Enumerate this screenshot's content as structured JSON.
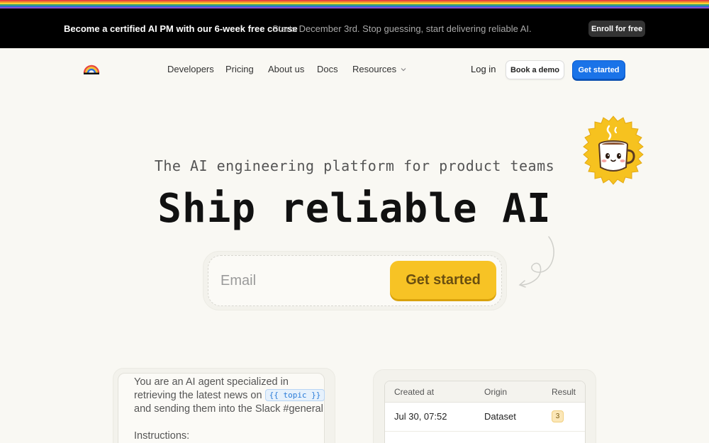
{
  "colors": {
    "stripe": [
      "#e8463c",
      "#f39a2b",
      "#f7d13a",
      "#3aa56b",
      "#2e6fd8",
      "#8a4fd0"
    ],
    "accent_blue": "#1a73e8",
    "accent_yellow": "#f7c325",
    "background": "#f9f8f3"
  },
  "banner": {
    "title": "Become a certified AI PM with our 6-week free course",
    "subtitle": "Starts December 3rd. Stop guessing, start delivering reliable AI.",
    "cta": "Enroll for free"
  },
  "nav": {
    "logo_icon": "rainbow-logo-icon",
    "links": [
      "Developers",
      "Pricing",
      "About us",
      "Docs",
      "Resources"
    ],
    "login": "Log in",
    "book_demo": "Book a demo",
    "get_started": "Get started"
  },
  "hero": {
    "tagline": "The AI engineering platform for product teams",
    "headline": "Ship reliable AI",
    "email_placeholder": "Email",
    "cta": "Get started",
    "mascot_icon": "coffee-mug-mascot-icon"
  },
  "prompt_card": {
    "line1": "You are an AI agent specialized in",
    "line2_prefix": "retrieving the latest news on",
    "variable": "{{ topic }}",
    "line3": "and sending them into the Slack #general",
    "line4": "Instructions:"
  },
  "results_table": {
    "headers": [
      "Created at",
      "Origin",
      "Result"
    ],
    "rows": [
      {
        "created_at": "Jul 30, 07:52",
        "origin": "Dataset",
        "result": "3"
      }
    ]
  }
}
